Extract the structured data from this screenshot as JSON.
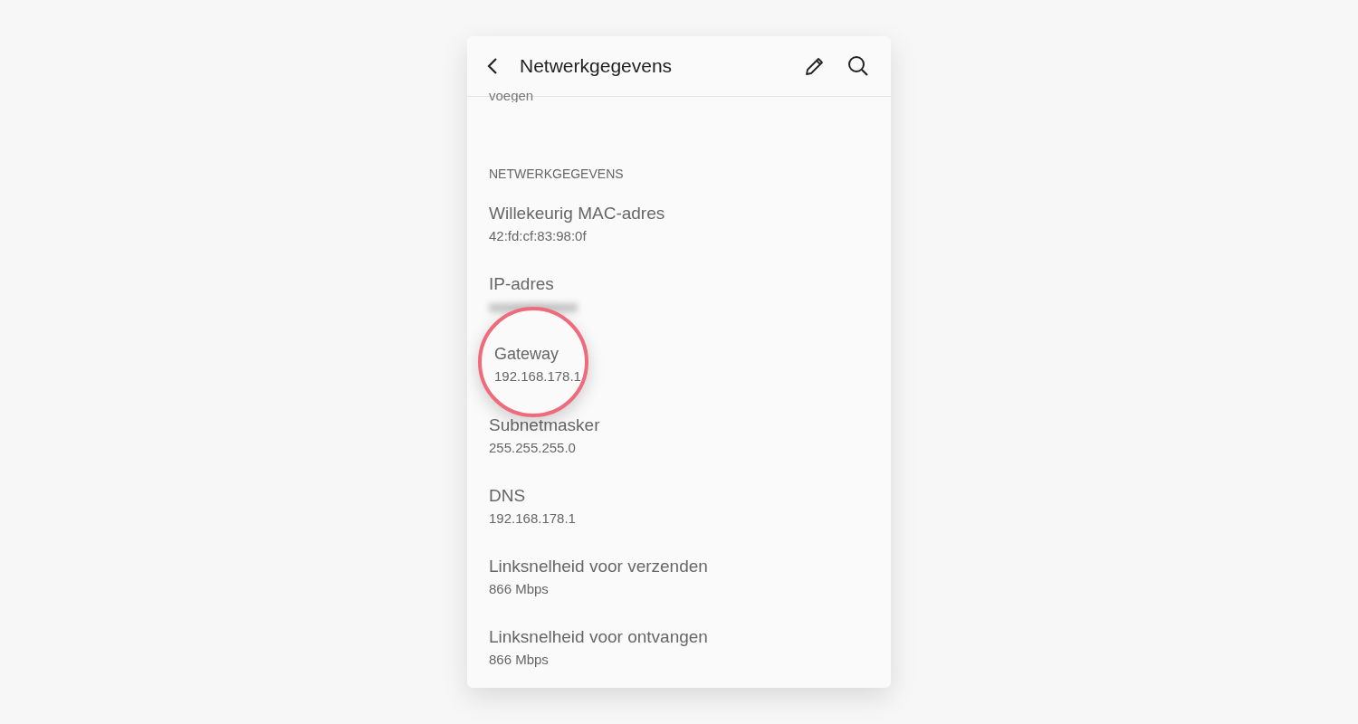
{
  "header": {
    "title": "Netwerkgegevens"
  },
  "partial_text": "voegen",
  "section": {
    "heading": "NETWERKGEGEVENS",
    "rows": [
      {
        "kind": "plain",
        "label": "Willekeurig MAC-adres",
        "value": "42:fd:cf:83:98:0f"
      },
      {
        "kind": "redacted",
        "label": "IP-adres"
      },
      {
        "kind": "magnified",
        "label": "Gateway",
        "value": "192.168.178.1"
      },
      {
        "kind": "plain",
        "label": "Subnetmasker",
        "value": "255.255.255.0"
      },
      {
        "kind": "plain",
        "label": "DNS",
        "value": "192.168.178.1"
      },
      {
        "kind": "plain",
        "label": "Linksnelheid voor verzenden",
        "value": "866 Mbps"
      },
      {
        "kind": "plain",
        "label": "Linksnelheid voor ontvangen",
        "value": "866 Mbps"
      }
    ]
  }
}
